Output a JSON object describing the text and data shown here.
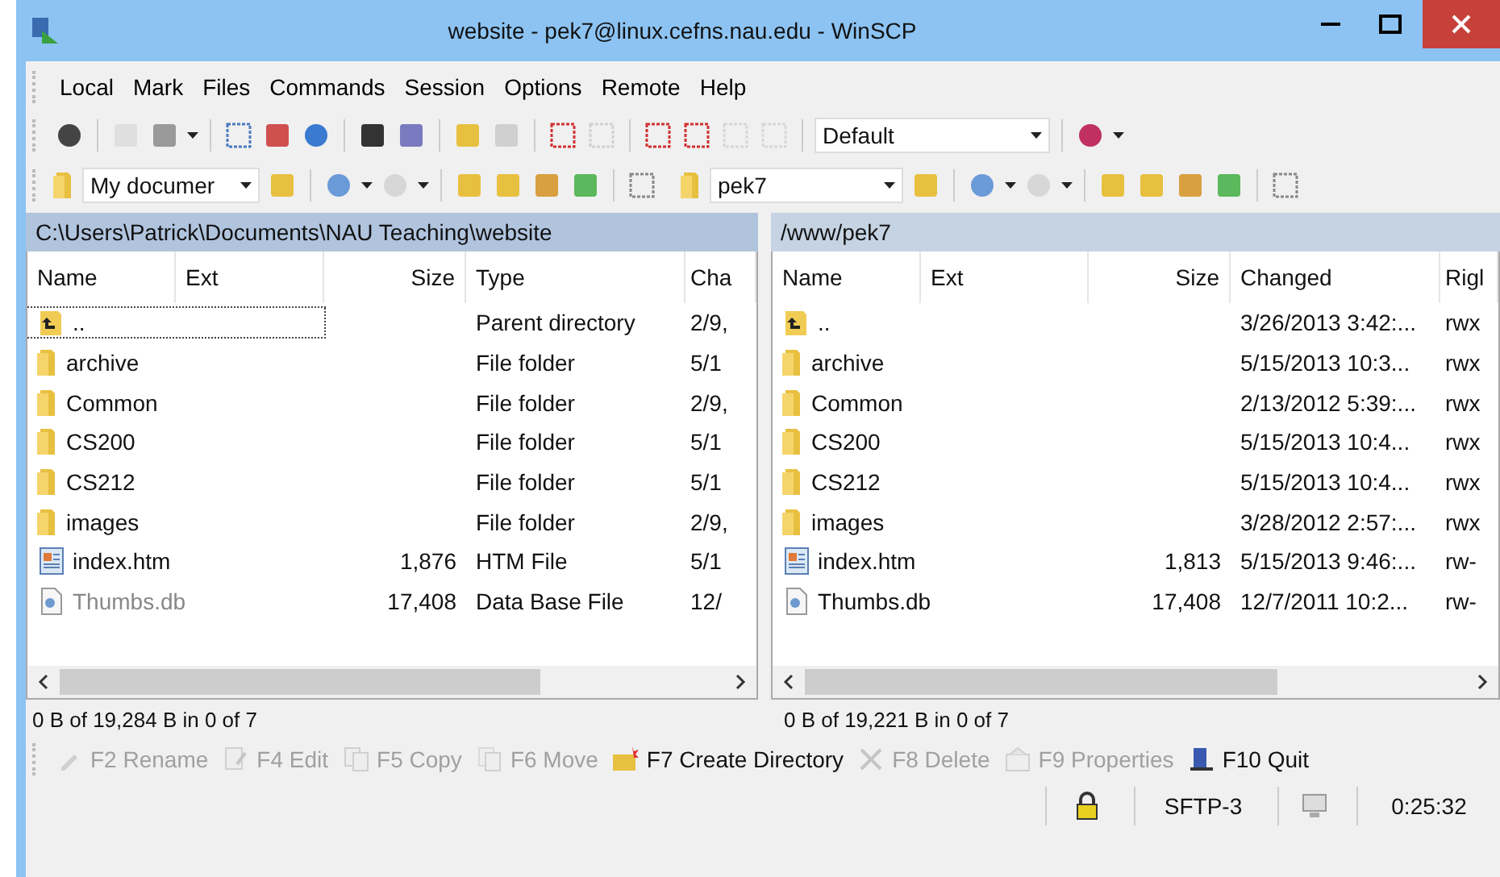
{
  "window": {
    "title": "website - pek7@linux.cefns.nau.edu - WinSCP"
  },
  "menu": [
    {
      "label": "Local"
    },
    {
      "label": "Mark"
    },
    {
      "label": "Files"
    },
    {
      "label": "Commands"
    },
    {
      "label": "Session"
    },
    {
      "label": "Options"
    },
    {
      "label": "Remote"
    },
    {
      "label": "Help"
    }
  ],
  "toolbar": {
    "profile": "Default"
  },
  "panels": [
    {
      "location": "My documer",
      "path": "C:\\Users\\Patrick\\Documents\\NAU Teaching\\website",
      "columns": [
        "Name",
        "Ext",
        "Size",
        "Type",
        "Cha"
      ],
      "summary": "0 B of 19,284 B in 0 of 7",
      "active": true,
      "rows": [
        {
          "kind": "parent",
          "name": "..",
          "size": "",
          "col4": "Parent directory",
          "col5": "2/9,",
          "dimmed": false,
          "focused": true
        },
        {
          "kind": "folder",
          "name": "archive",
          "size": "",
          "col4": "File folder",
          "col5": "5/1",
          "dimmed": false,
          "focused": false
        },
        {
          "kind": "folder",
          "name": "Common",
          "size": "",
          "col4": "File folder",
          "col5": "2/9,",
          "dimmed": false,
          "focused": false
        },
        {
          "kind": "folder",
          "name": "CS200",
          "size": "",
          "col4": "File folder",
          "col5": "5/1",
          "dimmed": false,
          "focused": false
        },
        {
          "kind": "folder",
          "name": "CS212",
          "size": "",
          "col4": "File folder",
          "col5": "5/1",
          "dimmed": false,
          "focused": false
        },
        {
          "kind": "folder",
          "name": "images",
          "size": "",
          "col4": "File folder",
          "col5": "2/9,",
          "dimmed": false,
          "focused": false
        },
        {
          "kind": "html",
          "name": "index.htm",
          "size": "1,876",
          "col4": "HTM File",
          "col5": "5/1",
          "dimmed": false,
          "focused": false
        },
        {
          "kind": "db",
          "name": "Thumbs.db",
          "size": "17,408",
          "col4": "Data Base File",
          "col5": "12/",
          "dimmed": true,
          "focused": false
        }
      ]
    },
    {
      "location": "pek7",
      "path": "/www/pek7",
      "columns": [
        "Name",
        "Ext",
        "Size",
        "Changed",
        "Rigl"
      ],
      "summary": "0 B of 19,221 B in 0 of 7",
      "active": false,
      "rows": [
        {
          "kind": "parent",
          "name": "..",
          "size": "",
          "col4": "3/26/2013 3:42:...",
          "col5": "rwx",
          "dimmed": false,
          "focused": false
        },
        {
          "kind": "folder",
          "name": "archive",
          "size": "",
          "col4": "5/15/2013 10:3...",
          "col5": "rwx",
          "dimmed": false,
          "focused": false
        },
        {
          "kind": "folder",
          "name": "Common",
          "size": "",
          "col4": "2/13/2012 5:39:...",
          "col5": "rwx",
          "dimmed": false,
          "focused": false
        },
        {
          "kind": "folder",
          "name": "CS200",
          "size": "",
          "col4": "5/15/2013 10:4...",
          "col5": "rwx",
          "dimmed": false,
          "focused": false
        },
        {
          "kind": "folder",
          "name": "CS212",
          "size": "",
          "col4": "5/15/2013 10:4...",
          "col5": "rwx",
          "dimmed": false,
          "focused": false
        },
        {
          "kind": "folder",
          "name": "images",
          "size": "",
          "col4": "3/28/2012 2:57:...",
          "col5": "rwx",
          "dimmed": false,
          "focused": false
        },
        {
          "kind": "html",
          "name": "index.htm",
          "size": "1,813",
          "col4": "5/15/2013 9:46:...",
          "col5": "rw-",
          "dimmed": false,
          "focused": false
        },
        {
          "kind": "db",
          "name": "Thumbs.db",
          "size": "17,408",
          "col4": "12/7/2011 10:2...",
          "col5": "rw-",
          "dimmed": false,
          "focused": false
        }
      ]
    }
  ],
  "commands": [
    {
      "kind": "rename",
      "label": "F2 Rename",
      "disabled": true
    },
    {
      "kind": "edit",
      "label": "F4 Edit",
      "disabled": true
    },
    {
      "kind": "copy",
      "label": "F5 Copy",
      "disabled": true
    },
    {
      "kind": "move",
      "label": "F6 Move",
      "disabled": true
    },
    {
      "kind": "mkdir",
      "label": "F7 Create Directory",
      "disabled": false
    },
    {
      "kind": "delete",
      "label": "F8 Delete",
      "disabled": true
    },
    {
      "kind": "properties",
      "label": "F9 Properties",
      "disabled": true
    },
    {
      "kind": "quit",
      "label": "F10 Quit",
      "disabled": false
    }
  ],
  "status_bar": {
    "protocol": "SFTP-3",
    "elapsed": "0:25:32"
  }
}
